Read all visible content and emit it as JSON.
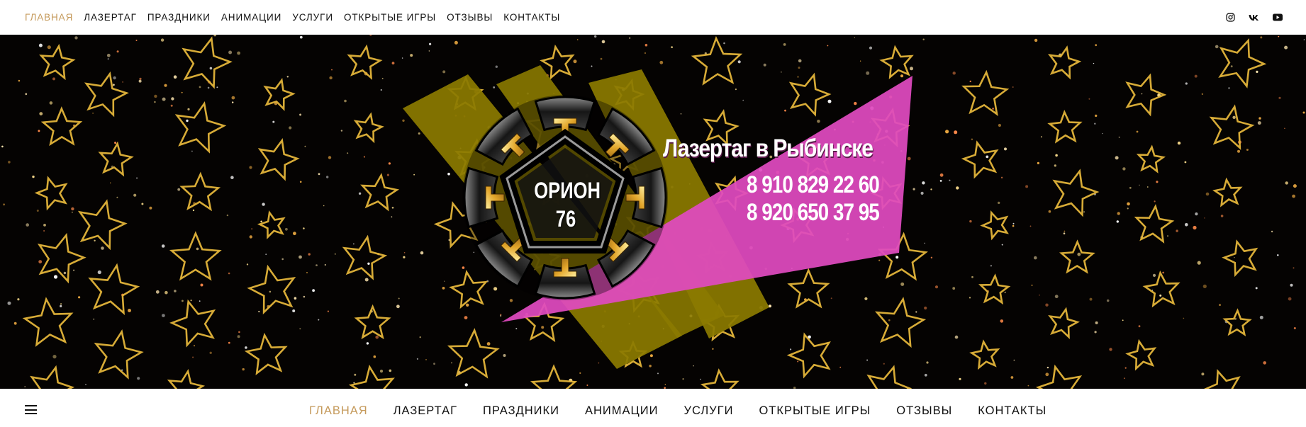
{
  "top_nav": {
    "items": [
      {
        "label": "ГЛАВНАЯ",
        "active": true
      },
      {
        "label": "ЛАЗЕРТАГ",
        "active": false
      },
      {
        "label": "ПРАЗДНИКИ",
        "active": false
      },
      {
        "label": "АНИМАЦИИ",
        "active": false
      },
      {
        "label": "УСЛУГИ",
        "active": false
      },
      {
        "label": "ОТКРЫТЫЕ ИГРЫ",
        "active": false
      },
      {
        "label": "ОТЗЫВЫ",
        "active": false
      },
      {
        "label": "КОНТАКТЫ",
        "active": false
      }
    ],
    "socials": [
      "instagram-icon",
      "vk-icon",
      "youtube-icon"
    ]
  },
  "hero": {
    "title": "Лазертаг в Рыбинске",
    "phone_1": "8 910 829 22 60",
    "phone_2": "8 920 650 37 95",
    "logo_line_1": "ОРИОН",
    "logo_line_2": "76"
  },
  "bottom_nav": {
    "menu_icon": "hamburger-menu-icon",
    "items": [
      {
        "label": "ГЛАВНАЯ",
        "active": true
      },
      {
        "label": "ЛАЗЕРТАГ",
        "active": false
      },
      {
        "label": "ПРАЗДНИКИ",
        "active": false
      },
      {
        "label": "АНИМАЦИИ",
        "active": false
      },
      {
        "label": "УСЛУГИ",
        "active": false
      },
      {
        "label": "ОТКРЫТЫЕ ИГРЫ",
        "active": false
      },
      {
        "label": "ОТЗЫВЫ",
        "active": false
      },
      {
        "label": "КОНТАКТЫ",
        "active": false
      }
    ]
  },
  "colors": {
    "accent": "#c59a5b",
    "text": "#111111",
    "hero_bg": "#050302",
    "olive": "#8b7a00",
    "magenta": "#e04ac0",
    "gold": "#e7b43c"
  }
}
